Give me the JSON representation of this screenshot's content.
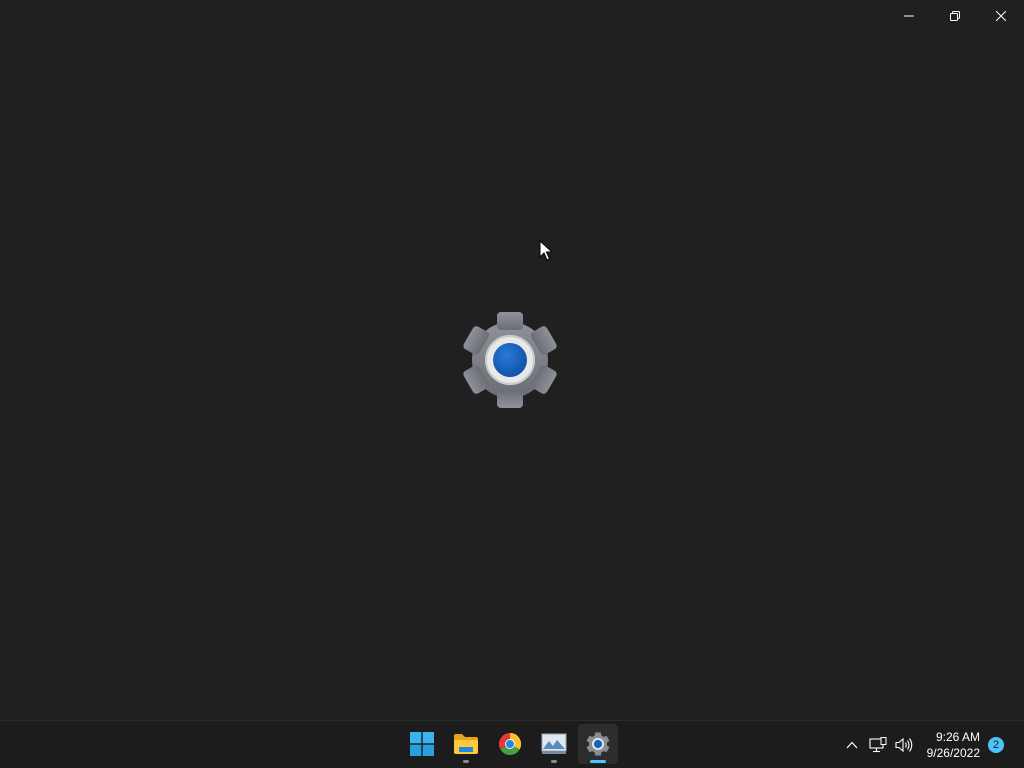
{
  "window": {
    "controls": {
      "minimize_icon": "minimize-icon",
      "restore_icon": "restore-icon",
      "close_icon": "close-icon"
    },
    "splash_icon": "settings-gear-icon"
  },
  "taskbar": {
    "apps": [
      {
        "name": "start",
        "icon": "windows-start-icon",
        "running": false,
        "active": false
      },
      {
        "name": "file-explorer",
        "icon": "folder-icon",
        "running": true,
        "active": false
      },
      {
        "name": "chrome",
        "icon": "chrome-icon",
        "running": false,
        "active": false
      },
      {
        "name": "photos",
        "icon": "image-icon",
        "running": true,
        "active": false
      },
      {
        "name": "settings",
        "icon": "settings-gear-icon",
        "running": true,
        "active": true
      }
    ],
    "tray": {
      "icons": [
        "chevron-up-icon",
        "network-icon",
        "volume-icon"
      ],
      "time": "9:26 AM",
      "date": "9/26/2022",
      "notification_count": "2"
    }
  },
  "colors": {
    "background": "#202020",
    "taskbar": "#1c1c1c",
    "accent": "#4cc2ff",
    "gear_blue": "#1565c0"
  }
}
